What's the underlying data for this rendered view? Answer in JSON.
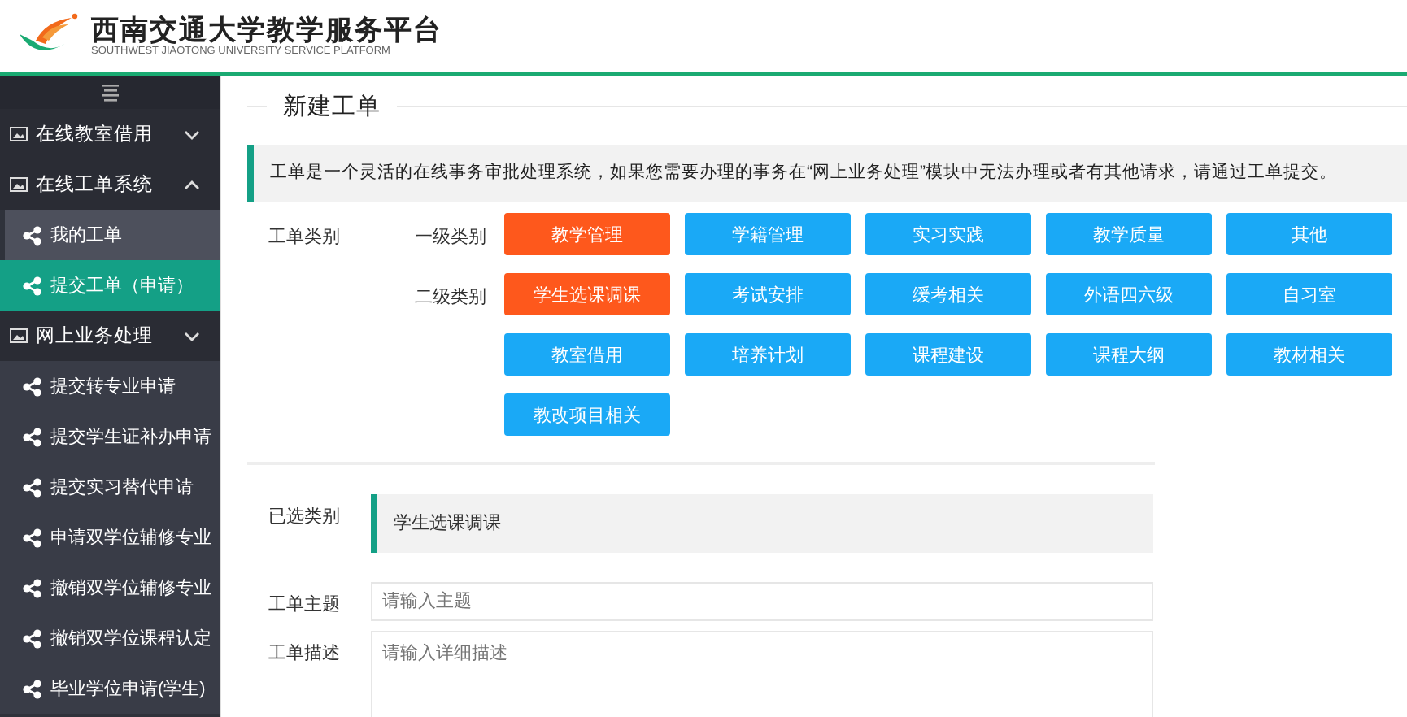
{
  "header": {
    "title": "西南交通大学教学服务平台",
    "subtitle": "SOUTHWEST JIAOTONG UNIVERSITY SERVICE PLATFORM"
  },
  "sidebar": {
    "groups": [
      {
        "label": "在线教室借用",
        "expanded": false
      },
      {
        "label": "在线工单系统",
        "expanded": true,
        "children": [
          {
            "label": "我的工单",
            "selected": false,
            "highlighted": true
          },
          {
            "label": "提交工单（申请）",
            "selected": true
          }
        ]
      },
      {
        "label": "网上业务处理",
        "expanded": false,
        "children": [
          {
            "label": "提交转专业申请",
            "selected": false
          },
          {
            "label": "提交学生证补办申请",
            "selected": false
          },
          {
            "label": "提交实习替代申请",
            "selected": false
          },
          {
            "label": "申请双学位辅修专业",
            "selected": false
          },
          {
            "label": "撤销双学位辅修专业",
            "selected": false
          },
          {
            "label": "撤销双学位课程认定",
            "selected": false
          },
          {
            "label": "毕业学位申请(学生)",
            "selected": false
          }
        ]
      }
    ]
  },
  "form": {
    "title": "新建工单",
    "notice": "工单是一个灵活的在线事务审批处理系统，如果您需要办理的事务在“网上业务处理”模块中无法办理或者有其他请求，请通过工单提交。",
    "category_label": "工单类别",
    "levels": [
      {
        "label": "一级类别",
        "options": [
          {
            "label": "教学管理",
            "selected": true
          },
          {
            "label": "学籍管理",
            "selected": false
          },
          {
            "label": "实习实践",
            "selected": false
          },
          {
            "label": "教学质量",
            "selected": false
          },
          {
            "label": "其他",
            "selected": false
          }
        ]
      },
      {
        "label": "二级类别",
        "options": [
          {
            "label": "学生选课调课",
            "selected": true
          },
          {
            "label": "考试安排",
            "selected": false
          },
          {
            "label": "缓考相关",
            "selected": false
          },
          {
            "label": "外语四六级",
            "selected": false
          },
          {
            "label": "自习室",
            "selected": false
          },
          {
            "label": "教室借用",
            "selected": false
          },
          {
            "label": "培养计划",
            "selected": false
          },
          {
            "label": "课程建设",
            "selected": false
          },
          {
            "label": "课程大纲",
            "selected": false
          },
          {
            "label": "教材相关",
            "selected": false
          },
          {
            "label": "教改项目相关",
            "selected": false
          }
        ]
      }
    ],
    "selected_label": "已选类别",
    "selected_value": "学生选课调课",
    "subject": {
      "label": "工单主题",
      "placeholder": "请输入主题"
    },
    "description": {
      "label": "工单描述",
      "placeholder": "请输入详细描述"
    }
  }
}
